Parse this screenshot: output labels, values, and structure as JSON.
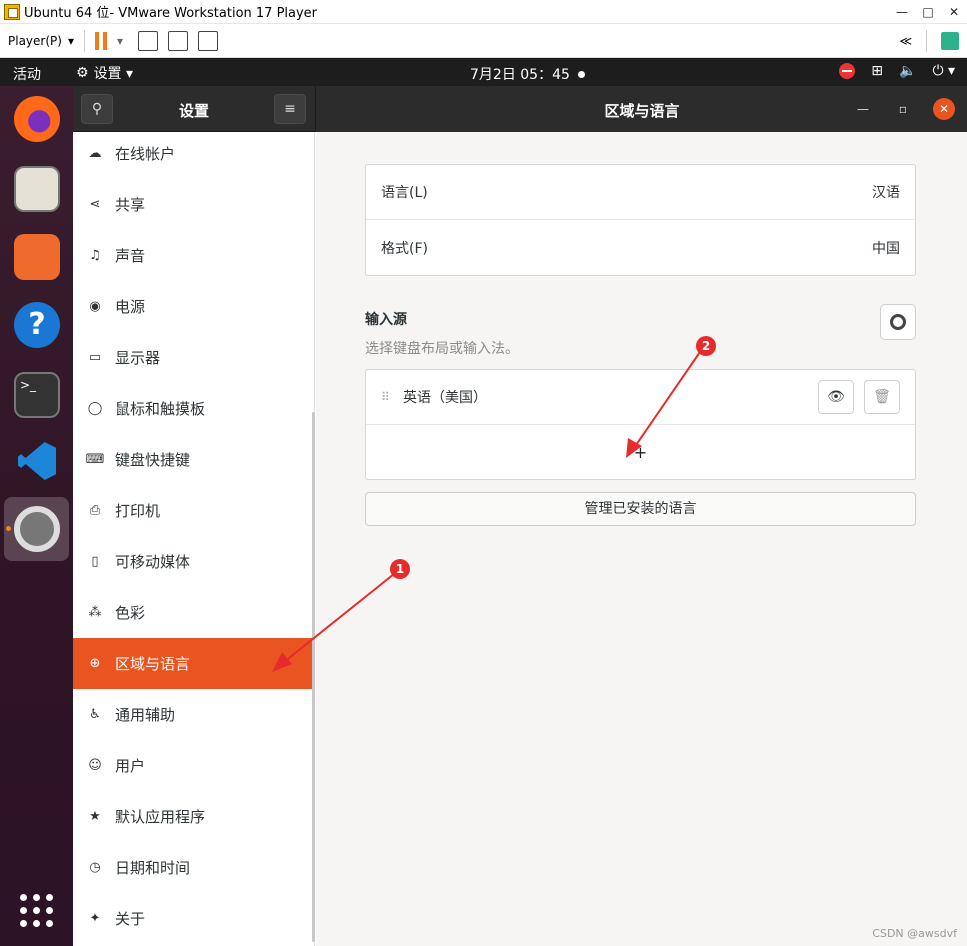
{
  "vm": {
    "title": "Ubuntu 64 位- VMware Workstation 17 Player",
    "window_controls": [
      "—",
      "□",
      "✕"
    ],
    "player_menu": "Player(P)",
    "right_btn": "≪"
  },
  "topbar": {
    "activities": "活动",
    "app_menu": "设置 ▾",
    "clock": "7月2日  05：45"
  },
  "dock": {
    "terminal_prompt": ">_"
  },
  "sidebar": {
    "title": "设置",
    "items": [
      {
        "label": "在线帐户",
        "icon": "cloud-icon"
      },
      {
        "label": "共享",
        "icon": "share-icon"
      },
      {
        "label": "声音",
        "icon": "music-note-icon"
      },
      {
        "label": "电源",
        "icon": "power-icon"
      },
      {
        "label": "显示器",
        "icon": "display-icon"
      },
      {
        "label": "鼠标和触摸板",
        "icon": "mouse-icon"
      },
      {
        "label": "键盘快捷键",
        "icon": "keyboard-icon"
      },
      {
        "label": "打印机",
        "icon": "printer-icon"
      },
      {
        "label": "可移动媒体",
        "icon": "usb-icon"
      },
      {
        "label": "色彩",
        "icon": "color-icon"
      },
      {
        "label": "区域与语言",
        "icon": "globe-icon",
        "active": true
      },
      {
        "label": "通用辅助",
        "icon": "accessibility-icon"
      },
      {
        "label": "用户",
        "icon": "users-icon"
      },
      {
        "label": "默认应用程序",
        "icon": "star-icon"
      },
      {
        "label": "日期和时间",
        "icon": "clock-icon"
      },
      {
        "label": "关于",
        "icon": "sparkle-icon"
      }
    ]
  },
  "main": {
    "title": "区域与语言",
    "language_label": "语言(L)",
    "language_value": "汉语",
    "format_label": "格式(F)",
    "format_value": "中国",
    "input_title": "输入源",
    "input_subtitle": "选择键盘布局或输入法。",
    "input_source": "英语（美国）",
    "add_symbol": "+",
    "manage_button": "管理已安装的语言"
  },
  "annotations": {
    "badge1": "1",
    "badge2": "2",
    "color": "#e52b2b"
  },
  "watermark": "CSDN @awsdvf",
  "colors": {
    "accent": "#e95420",
    "header": "#2c2c2c",
    "topbar": "#1d1d1d"
  }
}
